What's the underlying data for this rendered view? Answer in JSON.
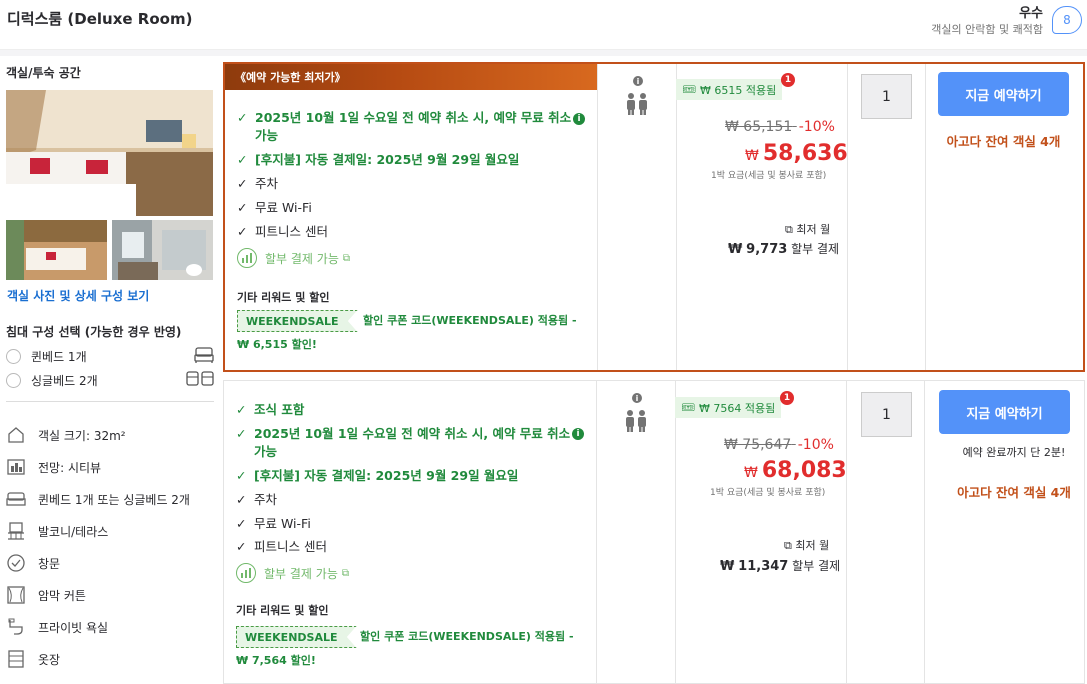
{
  "header": {
    "room_title": "디럭스룸 (Deluxe Room)",
    "score_word": "우수",
    "score_sub": "객실의 안락함 및 쾌적함",
    "score": "8"
  },
  "left": {
    "title": "객실/투숙 공간",
    "photo_link": "객실 사진 및 상세 구성 보기",
    "bed_title": "침대 구성 선택 (가능한 경우 반영)",
    "bed_options": [
      {
        "label": "퀸베드 1개",
        "icon": "queen-bed-icon"
      },
      {
        "label": "싱글베드 2개",
        "icon": "twin-bed-icon"
      }
    ],
    "amenities": [
      {
        "label": "객실 크기: 32m²",
        "icon": "room-size-icon"
      },
      {
        "label": "전망: 시티뷰",
        "icon": "city-view-icon"
      },
      {
        "label": "퀸베드 1개 또는 싱글베드 2개",
        "icon": "bed-icon"
      },
      {
        "label": "발코니/테라스",
        "icon": "balcony-icon"
      },
      {
        "label": "창문",
        "icon": "window-icon"
      },
      {
        "label": "암막 커튼",
        "icon": "curtain-icon"
      },
      {
        "label": "프라이빗 욕실",
        "icon": "bathroom-icon"
      },
      {
        "label": "옷장",
        "icon": "wardrobe-icon"
      }
    ]
  },
  "offers": [
    {
      "ribbon": "《예약 가능한 최저가》",
      "conditions_green": [
        "2025년 10월 1일 수요일 전 예약 취소 시, 예약 무료 취소 가능",
        "[후지불] 자동 결제일: 2025년 9월 29일 월요일"
      ],
      "conditions_plain": [
        "주차",
        "무료 Wi-Fi",
        "피트니스 센터"
      ],
      "installment": "할부 결제 가능",
      "reward_title": "기타 리워드 및 할인",
      "coupon_code": "WEEKENDSALE",
      "coupon_text_1": "할인 쿠폰 코드(WEEKENDSALE) 적용됨 -",
      "coupon_text_2": "₩ 6,515 할인!",
      "applied_tag": "₩ 6515 적용됨",
      "badge_count": "1",
      "original_price": "₩ 65,151",
      "discount_pct": "-10%",
      "currency": "₩",
      "final_price": "58,636",
      "price_note": "1박 요금(세금 및 봉사료 포함)",
      "monthly_label": "최저 월",
      "monthly_currency": "₩",
      "monthly_amount": "9,773",
      "monthly_suffix": "할부 결제",
      "quantity": "1",
      "book_label": "지금 예약하기",
      "rooms_left": "아고다 잔여 객실 4개",
      "urgency": ""
    },
    {
      "ribbon": "",
      "conditions_green": [
        "조식 포함",
        "2025년 10월 1일 수요일 전 예약 취소 시, 예약 무료 취소 가능",
        "[후지불] 자동 결제일: 2025년 9월 29일 월요일"
      ],
      "conditions_plain": [
        "주차",
        "무료 Wi-Fi",
        "피트니스 센터"
      ],
      "installment": "할부 결제 가능",
      "reward_title": "기타 리워드 및 할인",
      "coupon_code": "WEEKENDSALE",
      "coupon_text_1": "할인 쿠폰 코드(WEEKENDSALE) 적용됨 -",
      "coupon_text_2": "₩ 7,564 할인!",
      "applied_tag": "₩ 7564 적용됨",
      "badge_count": "1",
      "original_price": "₩ 75,647",
      "discount_pct": "-10%",
      "currency": "₩",
      "final_price": "68,083",
      "price_note": "1박 요금(세금 및 봉사료 포함)",
      "monthly_label": "최저 월",
      "monthly_currency": "₩",
      "monthly_amount": "11,347",
      "monthly_suffix": "할부 결제",
      "quantity": "1",
      "book_label": "지금 예약하기",
      "rooms_left": "아고다 잔여 객실 4개",
      "urgency": "예약 완료까지 단 2분!"
    }
  ],
  "colors": {
    "accent_blue": "#5392f9",
    "green": "#208a3c",
    "price_red": "#e12d2d",
    "ribbon_orange": "#c2501a"
  }
}
